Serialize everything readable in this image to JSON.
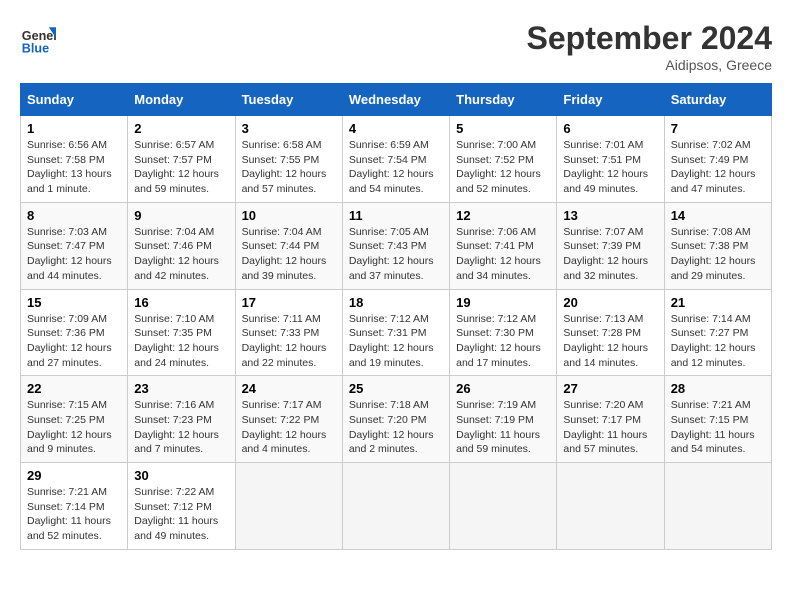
{
  "header": {
    "logo_line1": "General",
    "logo_line2": "Blue",
    "month": "September 2024",
    "location": "Aidipsos, Greece"
  },
  "weekdays": [
    "Sunday",
    "Monday",
    "Tuesday",
    "Wednesday",
    "Thursday",
    "Friday",
    "Saturday"
  ],
  "weeks": [
    [
      {
        "day": "1",
        "info": "Sunrise: 6:56 AM\nSunset: 7:58 PM\nDaylight: 13 hours\nand 1 minute."
      },
      {
        "day": "2",
        "info": "Sunrise: 6:57 AM\nSunset: 7:57 PM\nDaylight: 12 hours\nand 59 minutes."
      },
      {
        "day": "3",
        "info": "Sunrise: 6:58 AM\nSunset: 7:55 PM\nDaylight: 12 hours\nand 57 minutes."
      },
      {
        "day": "4",
        "info": "Sunrise: 6:59 AM\nSunset: 7:54 PM\nDaylight: 12 hours\nand 54 minutes."
      },
      {
        "day": "5",
        "info": "Sunrise: 7:00 AM\nSunset: 7:52 PM\nDaylight: 12 hours\nand 52 minutes."
      },
      {
        "day": "6",
        "info": "Sunrise: 7:01 AM\nSunset: 7:51 PM\nDaylight: 12 hours\nand 49 minutes."
      },
      {
        "day": "7",
        "info": "Sunrise: 7:02 AM\nSunset: 7:49 PM\nDaylight: 12 hours\nand 47 minutes."
      }
    ],
    [
      {
        "day": "8",
        "info": "Sunrise: 7:03 AM\nSunset: 7:47 PM\nDaylight: 12 hours\nand 44 minutes."
      },
      {
        "day": "9",
        "info": "Sunrise: 7:04 AM\nSunset: 7:46 PM\nDaylight: 12 hours\nand 42 minutes."
      },
      {
        "day": "10",
        "info": "Sunrise: 7:04 AM\nSunset: 7:44 PM\nDaylight: 12 hours\nand 39 minutes."
      },
      {
        "day": "11",
        "info": "Sunrise: 7:05 AM\nSunset: 7:43 PM\nDaylight: 12 hours\nand 37 minutes."
      },
      {
        "day": "12",
        "info": "Sunrise: 7:06 AM\nSunset: 7:41 PM\nDaylight: 12 hours\nand 34 minutes."
      },
      {
        "day": "13",
        "info": "Sunrise: 7:07 AM\nSunset: 7:39 PM\nDaylight: 12 hours\nand 32 minutes."
      },
      {
        "day": "14",
        "info": "Sunrise: 7:08 AM\nSunset: 7:38 PM\nDaylight: 12 hours\nand 29 minutes."
      }
    ],
    [
      {
        "day": "15",
        "info": "Sunrise: 7:09 AM\nSunset: 7:36 PM\nDaylight: 12 hours\nand 27 minutes."
      },
      {
        "day": "16",
        "info": "Sunrise: 7:10 AM\nSunset: 7:35 PM\nDaylight: 12 hours\nand 24 minutes."
      },
      {
        "day": "17",
        "info": "Sunrise: 7:11 AM\nSunset: 7:33 PM\nDaylight: 12 hours\nand 22 minutes."
      },
      {
        "day": "18",
        "info": "Sunrise: 7:12 AM\nSunset: 7:31 PM\nDaylight: 12 hours\nand 19 minutes."
      },
      {
        "day": "19",
        "info": "Sunrise: 7:12 AM\nSunset: 7:30 PM\nDaylight: 12 hours\nand 17 minutes."
      },
      {
        "day": "20",
        "info": "Sunrise: 7:13 AM\nSunset: 7:28 PM\nDaylight: 12 hours\nand 14 minutes."
      },
      {
        "day": "21",
        "info": "Sunrise: 7:14 AM\nSunset: 7:27 PM\nDaylight: 12 hours\nand 12 minutes."
      }
    ],
    [
      {
        "day": "22",
        "info": "Sunrise: 7:15 AM\nSunset: 7:25 PM\nDaylight: 12 hours\nand 9 minutes."
      },
      {
        "day": "23",
        "info": "Sunrise: 7:16 AM\nSunset: 7:23 PM\nDaylight: 12 hours\nand 7 minutes."
      },
      {
        "day": "24",
        "info": "Sunrise: 7:17 AM\nSunset: 7:22 PM\nDaylight: 12 hours\nand 4 minutes."
      },
      {
        "day": "25",
        "info": "Sunrise: 7:18 AM\nSunset: 7:20 PM\nDaylight: 12 hours\nand 2 minutes."
      },
      {
        "day": "26",
        "info": "Sunrise: 7:19 AM\nSunset: 7:19 PM\nDaylight: 11 hours\nand 59 minutes."
      },
      {
        "day": "27",
        "info": "Sunrise: 7:20 AM\nSunset: 7:17 PM\nDaylight: 11 hours\nand 57 minutes."
      },
      {
        "day": "28",
        "info": "Sunrise: 7:21 AM\nSunset: 7:15 PM\nDaylight: 11 hours\nand 54 minutes."
      }
    ],
    [
      {
        "day": "29",
        "info": "Sunrise: 7:21 AM\nSunset: 7:14 PM\nDaylight: 11 hours\nand 52 minutes."
      },
      {
        "day": "30",
        "info": "Sunrise: 7:22 AM\nSunset: 7:12 PM\nDaylight: 11 hours\nand 49 minutes."
      },
      {
        "day": "",
        "info": ""
      },
      {
        "day": "",
        "info": ""
      },
      {
        "day": "",
        "info": ""
      },
      {
        "day": "",
        "info": ""
      },
      {
        "day": "",
        "info": ""
      }
    ]
  ]
}
